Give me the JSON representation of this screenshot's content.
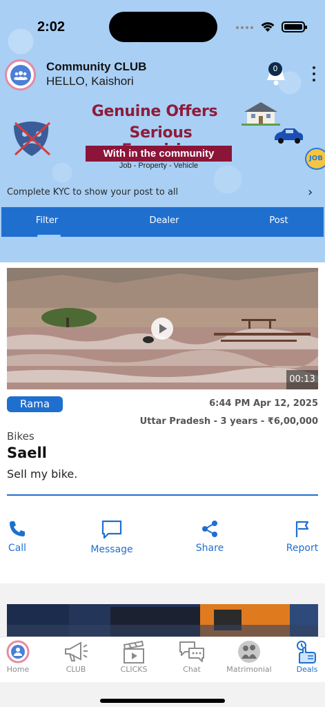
{
  "status_bar": {
    "time": "2:02"
  },
  "header": {
    "app_name": "Community CLUB",
    "greeting": "HELLO, Kaishori",
    "notification_count": "0",
    "icons": [
      "app-logo",
      "bell-icon",
      "more-vert-icon"
    ]
  },
  "banner": {
    "line1": "Genuine Offers",
    "line2": "Serious Enquiries",
    "strip": "With in the community",
    "sub": "Job - Property - Vehicle",
    "badge": "JOB"
  },
  "kyc": {
    "text": "Complete KYC to show your post to all",
    "chevron": "›"
  },
  "tabs": [
    {
      "label": "Filter",
      "active": true
    },
    {
      "label": "Dealer",
      "active": false
    },
    {
      "label": "Post",
      "active": false
    }
  ],
  "post": {
    "duration": "00:13",
    "user": "Rama",
    "time": "6:44 PM Apr 12, 2025",
    "meta": "Uttar Pradesh -  3 years - ₹6,00,000",
    "category": "Bikes",
    "title": "Saell",
    "description": "Sell my bike.",
    "actions": [
      {
        "label": "Call",
        "icon": "phone-icon"
      },
      {
        "label": "Message",
        "icon": "message-icon"
      },
      {
        "label": "Share",
        "icon": "share-icon"
      },
      {
        "label": "Report",
        "icon": "flag-icon"
      }
    ]
  },
  "bottom_nav": [
    {
      "label": "Home",
      "icon": "home-icon",
      "active": false
    },
    {
      "label": "CLUB",
      "icon": "megaphone-icon",
      "active": false
    },
    {
      "label": "CLICKS",
      "icon": "clapperboard-icon",
      "active": false
    },
    {
      "label": "Chat",
      "icon": "chat-icon",
      "active": false
    },
    {
      "label": "Matrimonial",
      "icon": "couple-icon",
      "active": false
    },
    {
      "label": "Deals",
      "icon": "deals-icon",
      "active": true
    }
  ],
  "colors": {
    "primary": "#1f6fcf",
    "header_bg": "#a9cff4",
    "banner_text": "#8e1b3b"
  }
}
